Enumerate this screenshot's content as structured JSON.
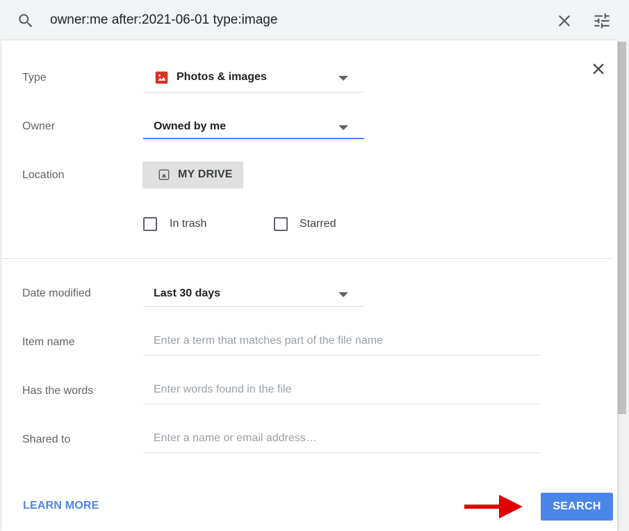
{
  "search": {
    "query": "owner:me after:2021-06-01 type:image"
  },
  "filters": {
    "type": {
      "label": "Type",
      "value": "Photos & images"
    },
    "owner": {
      "label": "Owner",
      "value": "Owned by me"
    },
    "location": {
      "label": "Location",
      "button_label": "MY DRIVE"
    },
    "in_trash": {
      "label": "In trash",
      "checked": false
    },
    "starred": {
      "label": "Starred",
      "checked": false
    },
    "date_modified": {
      "label": "Date modified",
      "value": "Last 30 days"
    },
    "item_name": {
      "label": "Item name",
      "placeholder": "Enter a term that matches part of the file name"
    },
    "has_words": {
      "label": "Has the words",
      "placeholder": "Enter words found in the file"
    },
    "shared_to": {
      "label": "Shared to",
      "placeholder": "Enter a name or email address…"
    }
  },
  "footer": {
    "learn_more": "LEARN MORE",
    "search_button": "SEARCH"
  },
  "colors": {
    "accent": "#4a86e8",
    "active_underline": "#4285f4",
    "arrow": "#e00000",
    "photo_icon": "#d93025"
  },
  "icons": {
    "search": "search-icon",
    "clear": "close-icon",
    "tune": "tune-icon",
    "panel_close": "close-icon",
    "type": "image-icon",
    "location": "drive-folder-icon",
    "caret": "caret-down-icon"
  }
}
